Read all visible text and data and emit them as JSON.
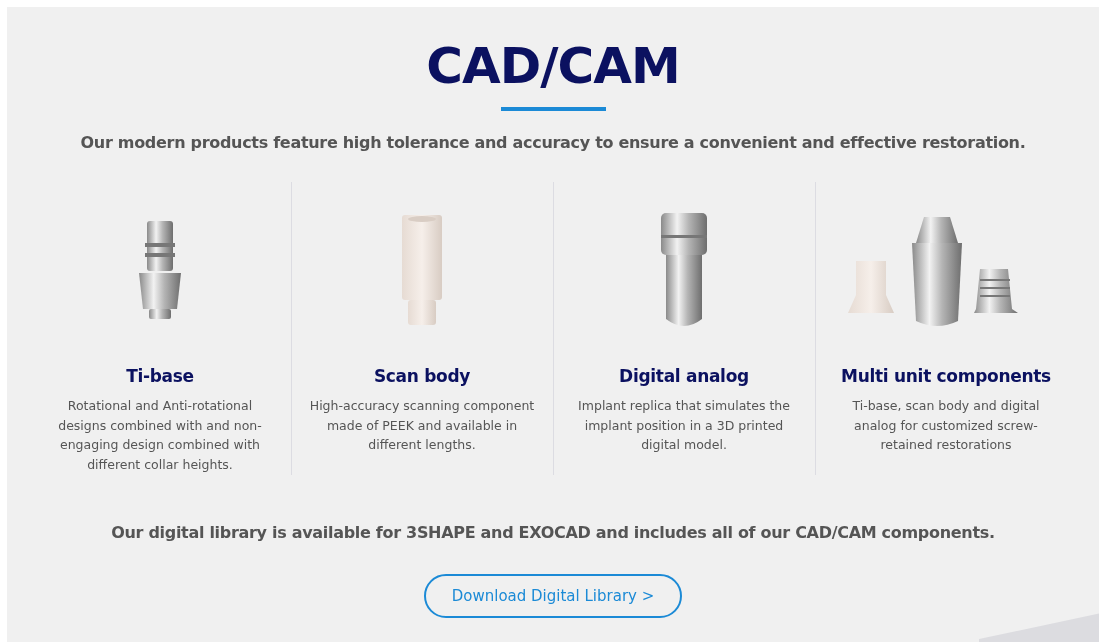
{
  "header": {
    "title": "CAD/CAM",
    "subtitle": "Our modern products feature high tolerance and accuracy to ensure a convenient and effective restoration."
  },
  "products": [
    {
      "kind": "tibase",
      "name": "Ti-base",
      "description": "Rotational and Anti-rotational designs combined with and non-engaging design combined with different collar heights."
    },
    {
      "kind": "scanbody",
      "name": "Scan body",
      "description": "High-accuracy scanning component made of PEEK and available in different lengths."
    },
    {
      "kind": "analog",
      "name": "Digital analog",
      "description": "Implant replica that simulates the implant position in a 3D printed digital model."
    },
    {
      "kind": "multiunit",
      "name": "Multi unit components",
      "description": "Ti-base, scan body and digital analog for customized screw-retained restorations"
    }
  ],
  "footer": {
    "note": "Our digital library is available for 3SHAPE and EXOCAD and includes all of our CAD/CAM components.",
    "button": "Download Digital Library >"
  }
}
